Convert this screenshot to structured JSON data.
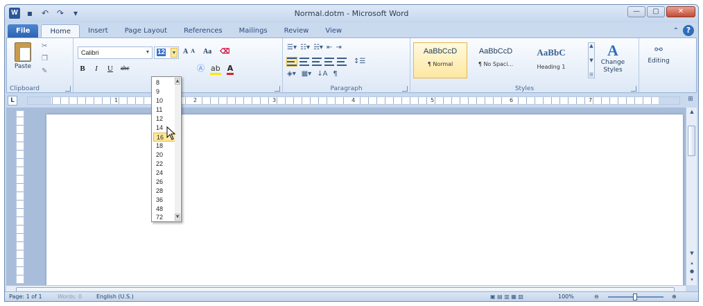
{
  "title": "Normal.dotm - Microsoft Word",
  "app_logo": "W",
  "window_controls": {
    "minimize": "—",
    "maximize": "▢",
    "close": "✕"
  },
  "tabs": [
    {
      "label": "File"
    },
    {
      "label": "Home"
    },
    {
      "label": "Insert"
    },
    {
      "label": "Page Layout"
    },
    {
      "label": "References"
    },
    {
      "label": "Mailings"
    },
    {
      "label": "Review"
    },
    {
      "label": "View"
    }
  ],
  "ribbon": {
    "clipboard": {
      "label": "Clipboard",
      "paste": "Paste"
    },
    "font": {
      "name": "Calibri",
      "size": "12",
      "grow": "A",
      "shrink": "A",
      "change_case": "Aa",
      "bold": "B",
      "italic": "I",
      "underline": "U",
      "strike": "abc"
    },
    "paragraph": {
      "label": "Paragraph"
    },
    "styles": {
      "label": "Styles",
      "items": [
        {
          "preview": "AaBbCcD",
          "name": "¶ Normal"
        },
        {
          "preview": "AaBbCcD",
          "name": "¶ No Spaci..."
        },
        {
          "preview": "AaBbC",
          "name": "Heading 1"
        }
      ],
      "change_styles": "Change Styles"
    },
    "editing": {
      "label": "Editing"
    }
  },
  "ruler_numbers": [
    "1",
    "2",
    "3",
    "4",
    "5",
    "6",
    "7"
  ],
  "font_size_dropdown": {
    "options": [
      "8",
      "9",
      "10",
      "11",
      "12",
      "14",
      "16",
      "18",
      "20",
      "22",
      "24",
      "26",
      "28",
      "36",
      "48",
      "72"
    ],
    "hovered": "16"
  },
  "status": {
    "page": "Page: 1 of 1",
    "words": "Words: 0",
    "language": "English (U.S.)",
    "zoom": "100%"
  },
  "colors": {
    "accent": "#2b579a",
    "font_color": "#e02020",
    "highlight": "#ffe800"
  }
}
